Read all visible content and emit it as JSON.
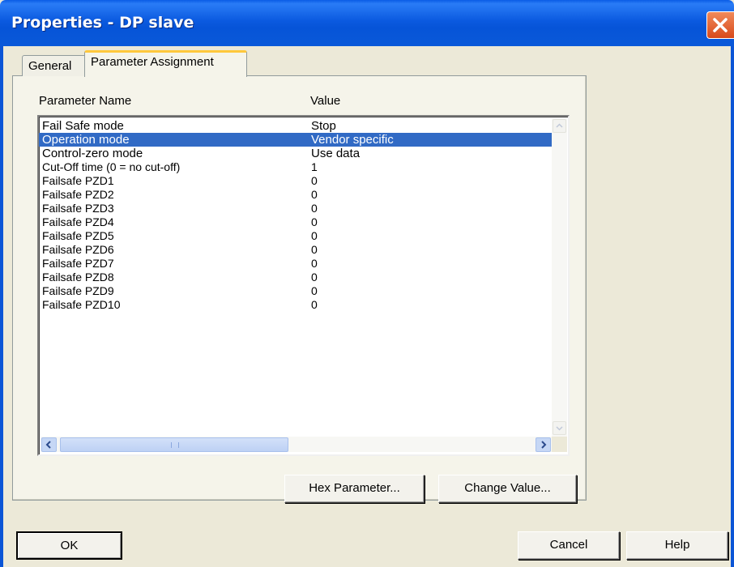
{
  "window": {
    "title": "Properties - DP slave"
  },
  "tabs": [
    {
      "label": "General",
      "active": false
    },
    {
      "label": "Parameter Assignment",
      "active": true
    }
  ],
  "list": {
    "headers": {
      "name": "Parameter Name",
      "value": "Value"
    },
    "selected_index": 1,
    "rows": [
      {
        "name": "Fail Safe mode",
        "value": "Stop"
      },
      {
        "name": "Operation mode",
        "value": "Vendor specific"
      },
      {
        "name": "Control-zero mode",
        "value": "Use data"
      },
      {
        "name": "Cut-Off time (0 = no cut-off)",
        "value": "1"
      },
      {
        "name": "Failsafe PZD1",
        "value": "0"
      },
      {
        "name": "Failsafe PZD2",
        "value": "0"
      },
      {
        "name": "Failsafe PZD3",
        "value": "0"
      },
      {
        "name": "Failsafe PZD4",
        "value": "0"
      },
      {
        "name": "Failsafe PZD5",
        "value": "0"
      },
      {
        "name": "Failsafe PZD6",
        "value": "0"
      },
      {
        "name": "Failsafe PZD7",
        "value": "0"
      },
      {
        "name": "Failsafe PZD8",
        "value": "0"
      },
      {
        "name": "Failsafe PZD9",
        "value": "0"
      },
      {
        "name": "Failsafe PZD10",
        "value": "0"
      }
    ]
  },
  "buttons": {
    "hex_parameter": "Hex Parameter...",
    "change_value": "Change Value...",
    "ok": "OK",
    "cancel": "Cancel",
    "help": "Help"
  },
  "colors": {
    "title_bar": "#0b5ae0",
    "selection": "#316ac5",
    "close_button": "#d84a1c",
    "tab_highlight": "#ffc83c"
  }
}
